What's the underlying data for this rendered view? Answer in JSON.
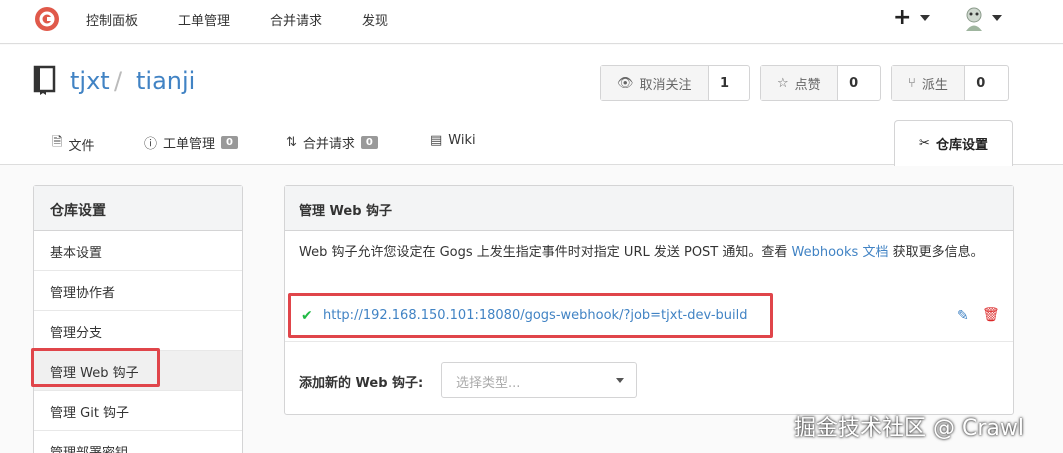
{
  "topnav": {
    "items": [
      "控制面板",
      "工单管理",
      "合并请求",
      "发现"
    ],
    "plus": "+"
  },
  "repo": {
    "owner": "tjxt",
    "separator": "/",
    "name": "tianji",
    "watch": {
      "label": "取消关注",
      "count": "1"
    },
    "star": {
      "label": "点赞",
      "count": "0"
    },
    "fork": {
      "label": "派生",
      "count": "0"
    }
  },
  "tabs": {
    "files": "文件",
    "issues": "工单管理",
    "issues_count": "0",
    "pulls": "合并请求",
    "pulls_count": "0",
    "wiki": "Wiki",
    "settings": "仓库设置"
  },
  "sidebar": {
    "title": "仓库设置",
    "items": [
      "基本设置",
      "管理协作者",
      "管理分支",
      "管理 Web 钩子",
      "管理 Git 钩子",
      "管理部署密钥"
    ]
  },
  "panel": {
    "title": "管理 Web 钩子",
    "desc_before": "Web 钩子允许您设定在 Gogs 上发生指定事件时对指定 URL 发送 POST 通知。查看 ",
    "desc_link": "Webhooks 文档",
    "desc_after": " 获取更多信息。",
    "hook_url": "http://192.168.150.101:18080/gogs-webhook/?job=tjxt-dev-build",
    "add_label": "添加新的 Web 钩子:",
    "select_placeholder": "选择类型..."
  },
  "watermark": "掘金技术社区 @ Crawl",
  "colors": {
    "link": "#4183c4",
    "success": "#21ba45",
    "danger": "#db2828",
    "highlight": "#e0454a"
  }
}
